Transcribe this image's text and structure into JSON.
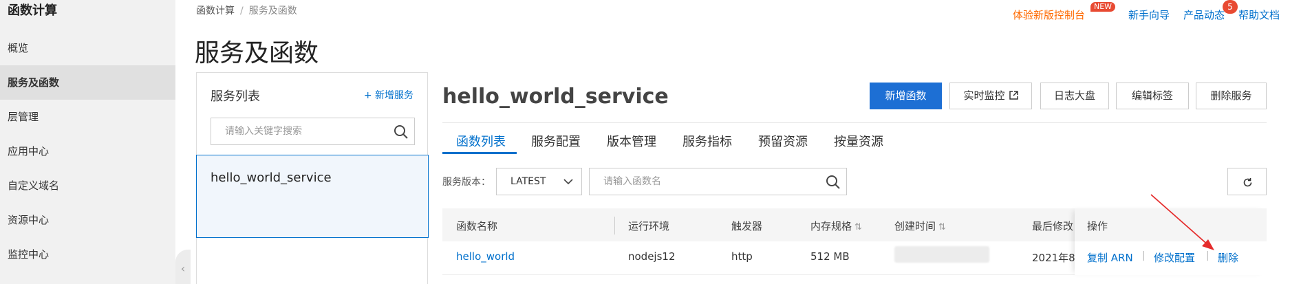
{
  "app": {
    "title": "函数计算"
  },
  "sidebar": {
    "items": [
      {
        "label": "概览"
      },
      {
        "label": "服务及函数"
      },
      {
        "label": "层管理"
      },
      {
        "label": "应用中心"
      },
      {
        "label": "自定义域名"
      },
      {
        "label": "资源中心"
      },
      {
        "label": "监控中心"
      }
    ],
    "active_index": 1,
    "collapse_icon": "chevron-left-icon"
  },
  "breadcrumb": {
    "items": [
      "函数计算",
      "服务及函数"
    ],
    "separator": "/"
  },
  "page_title": "服务及函数",
  "top_links": {
    "new_console": "体验新版控制台",
    "new_badge": "NEW",
    "guide": "新手向导",
    "product_news": "产品动态",
    "product_news_count": "5",
    "help_docs": "帮助文档"
  },
  "service_list": {
    "title": "服务列表",
    "add_label": "+ 新增服务",
    "search_placeholder": "请输入关键字搜索",
    "services": [
      {
        "name": "hello_world_service"
      }
    ]
  },
  "service": {
    "name": "hello_world_service",
    "buttons": {
      "add_function": "新增函数",
      "realtime_monitor": "实时监控",
      "log_dashboard": "日志大盘",
      "edit_tags": "编辑标签",
      "delete_service": "删除服务"
    },
    "tabs": [
      "函数列表",
      "服务配置",
      "版本管理",
      "服务指标",
      "预留资源",
      "按量资源"
    ],
    "active_tab": 0,
    "version_label": "服务版本：",
    "version_value": "LATEST",
    "function_search_placeholder": "请输入函数名"
  },
  "table": {
    "columns": [
      "函数名称",
      "运行环境",
      "触发器",
      "内存规格",
      "创建时间",
      "最后修改"
    ],
    "ops_header": "操作",
    "rows": [
      {
        "name": "hello_world",
        "runtime": "nodejs12",
        "trigger": "http",
        "memory": "512 MB",
        "created": "",
        "modified": "2021年8",
        "ops": [
          "复制 ARN",
          "修改配置",
          "删除"
        ]
      }
    ]
  },
  "colors": {
    "accent": "#0070cc",
    "primary_button": "#1d6fd4",
    "badge": "#e84a32",
    "orange_link": "#ff6a00",
    "annotation_arrow": "#e52c2c"
  }
}
